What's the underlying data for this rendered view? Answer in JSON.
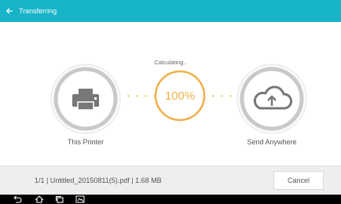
{
  "appbar": {
    "title": "Transferring",
    "back_icon": "back-arrow-icon"
  },
  "transfer": {
    "source": {
      "label": "This Printer",
      "icon": "printer-icon"
    },
    "target": {
      "label": "Send Anywhere",
      "icon": "cloud-upload-icon"
    },
    "status_text": "Calculating..",
    "progress_text": "100%",
    "progress": 1.0
  },
  "file_info": "1/1  |  Untitled_20150811(5).pdf  |  1.68 MB",
  "cancel_label": "Cancel",
  "navbar": {
    "icons": [
      "back-icon",
      "home-icon",
      "recent-apps-icon",
      "screenshot-icon"
    ]
  },
  "colors": {
    "appbar": "#17b3c9",
    "accent": "#f0b24a",
    "circle": "#cfcfcf",
    "icon": "#777777"
  }
}
